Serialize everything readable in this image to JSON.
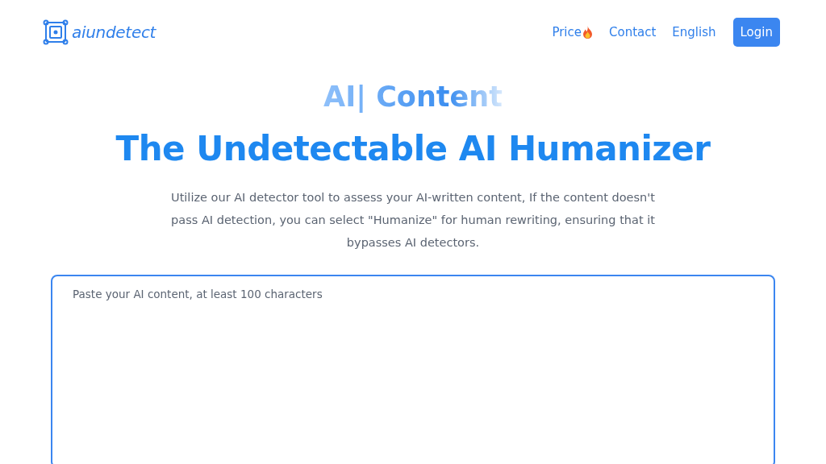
{
  "logo": {
    "text": "aiundetect"
  },
  "nav": [
    {
      "label": "Price",
      "kind": "hot"
    },
    {
      "label": "Contact",
      "kind": "link"
    },
    {
      "label": "English",
      "kind": "link"
    }
  ],
  "login": {
    "label": "Login"
  },
  "hero": {
    "typing": "AI| Content",
    "title": "The Undetectable AI Humanizer",
    "description": "Utilize our AI detector tool to assess your AI-written content, If the content doesn't pass AI detection, you can select \"Humanize\" for human rewriting, ensuring that it bypasses AI detectors."
  },
  "editor": {
    "placeholder": "Paste your AI content, at least 100 characters"
  }
}
